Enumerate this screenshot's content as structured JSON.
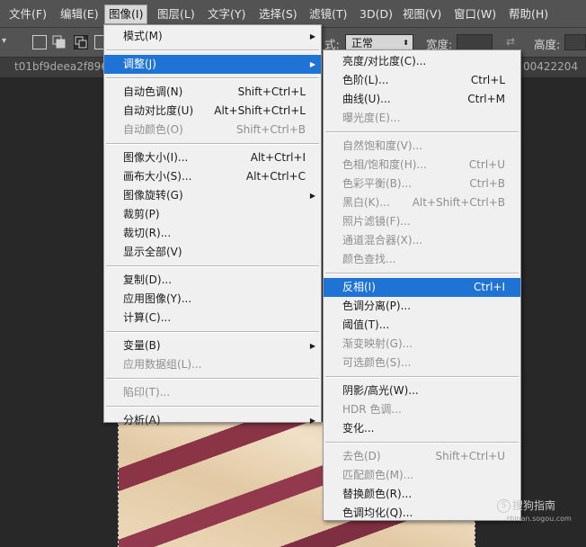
{
  "menubar": [
    "文件(F)",
    "编辑(E)",
    "图像(I)",
    "图层(L)",
    "文字(Y)",
    "选择(S)",
    "滤镜(T)",
    "3D(D)",
    "视图(V)",
    "窗口(W)",
    "帮助(H)"
  ],
  "options": {
    "blend_partial": "式:",
    "mode_value": "正常",
    "width_label": "宽度:",
    "height_label": "高度:"
  },
  "tab": {
    "title_left": "t01bf9deea2f8968",
    "title_right": "00422204"
  },
  "image_menu": [
    {
      "label": "模式(M)",
      "submenu": true
    },
    {
      "sep": true
    },
    {
      "label": "调整(J)",
      "submenu": true,
      "highlighted": true
    },
    {
      "sep": true
    },
    {
      "label": "自动色调(N)",
      "shortcut": "Shift+Ctrl+L"
    },
    {
      "label": "自动对比度(U)",
      "shortcut": "Alt+Shift+Ctrl+L"
    },
    {
      "label": "自动颜色(O)",
      "shortcut": "Shift+Ctrl+B",
      "disabled": true
    },
    {
      "sep": true
    },
    {
      "label": "图像大小(I)...",
      "shortcut": "Alt+Ctrl+I"
    },
    {
      "label": "画布大小(S)...",
      "shortcut": "Alt+Ctrl+C"
    },
    {
      "label": "图像旋转(G)",
      "submenu": true
    },
    {
      "label": "裁剪(P)"
    },
    {
      "label": "裁切(R)..."
    },
    {
      "label": "显示全部(V)"
    },
    {
      "sep": true
    },
    {
      "label": "复制(D)..."
    },
    {
      "label": "应用图像(Y)..."
    },
    {
      "label": "计算(C)..."
    },
    {
      "sep": true
    },
    {
      "label": "变量(B)",
      "submenu": true
    },
    {
      "label": "应用数据组(L)...",
      "disabled": true
    },
    {
      "sep": true
    },
    {
      "label": "陷印(T)...",
      "disabled": true
    },
    {
      "sep": true
    },
    {
      "label": "分析(A)",
      "submenu": true
    }
  ],
  "adjust_menu": [
    {
      "label": "亮度/对比度(C)..."
    },
    {
      "label": "色阶(L)...",
      "shortcut": "Ctrl+L"
    },
    {
      "label": "曲线(U)...",
      "shortcut": "Ctrl+M"
    },
    {
      "label": "曝光度(E)...",
      "disabled": true
    },
    {
      "sep": true
    },
    {
      "label": "自然饱和度(V)...",
      "disabled": true
    },
    {
      "label": "色相/饱和度(H)...",
      "shortcut": "Ctrl+U",
      "disabled": true
    },
    {
      "label": "色彩平衡(B)...",
      "shortcut": "Ctrl+B",
      "disabled": true
    },
    {
      "label": "黑白(K)...",
      "shortcut": "Alt+Shift+Ctrl+B",
      "disabled": true
    },
    {
      "label": "照片滤镜(F)...",
      "disabled": true
    },
    {
      "label": "通道混合器(X)...",
      "disabled": true
    },
    {
      "label": "颜色查找...",
      "disabled": true
    },
    {
      "sep": true
    },
    {
      "label": "反相(I)",
      "shortcut": "Ctrl+I",
      "highlighted": true
    },
    {
      "label": "色调分离(P)..."
    },
    {
      "label": "阈值(T)..."
    },
    {
      "label": "渐变映射(G)...",
      "disabled": true
    },
    {
      "label": "可选颜色(S)...",
      "disabled": true
    },
    {
      "sep": true
    },
    {
      "label": "阴影/高光(W)..."
    },
    {
      "label": "HDR 色调...",
      "disabled": true
    },
    {
      "label": "变化..."
    },
    {
      "sep": true
    },
    {
      "label": "去色(D)",
      "shortcut": "Shift+Ctrl+U",
      "disabled": true
    },
    {
      "label": "匹配颜色(M)...",
      "disabled": true
    },
    {
      "label": "替换颜色(R)..."
    },
    {
      "label": "色调均化(Q)..."
    }
  ],
  "watermark": {
    "logo": "S",
    "text": "搜狗指南",
    "url": "zhinan.sogou.com"
  }
}
